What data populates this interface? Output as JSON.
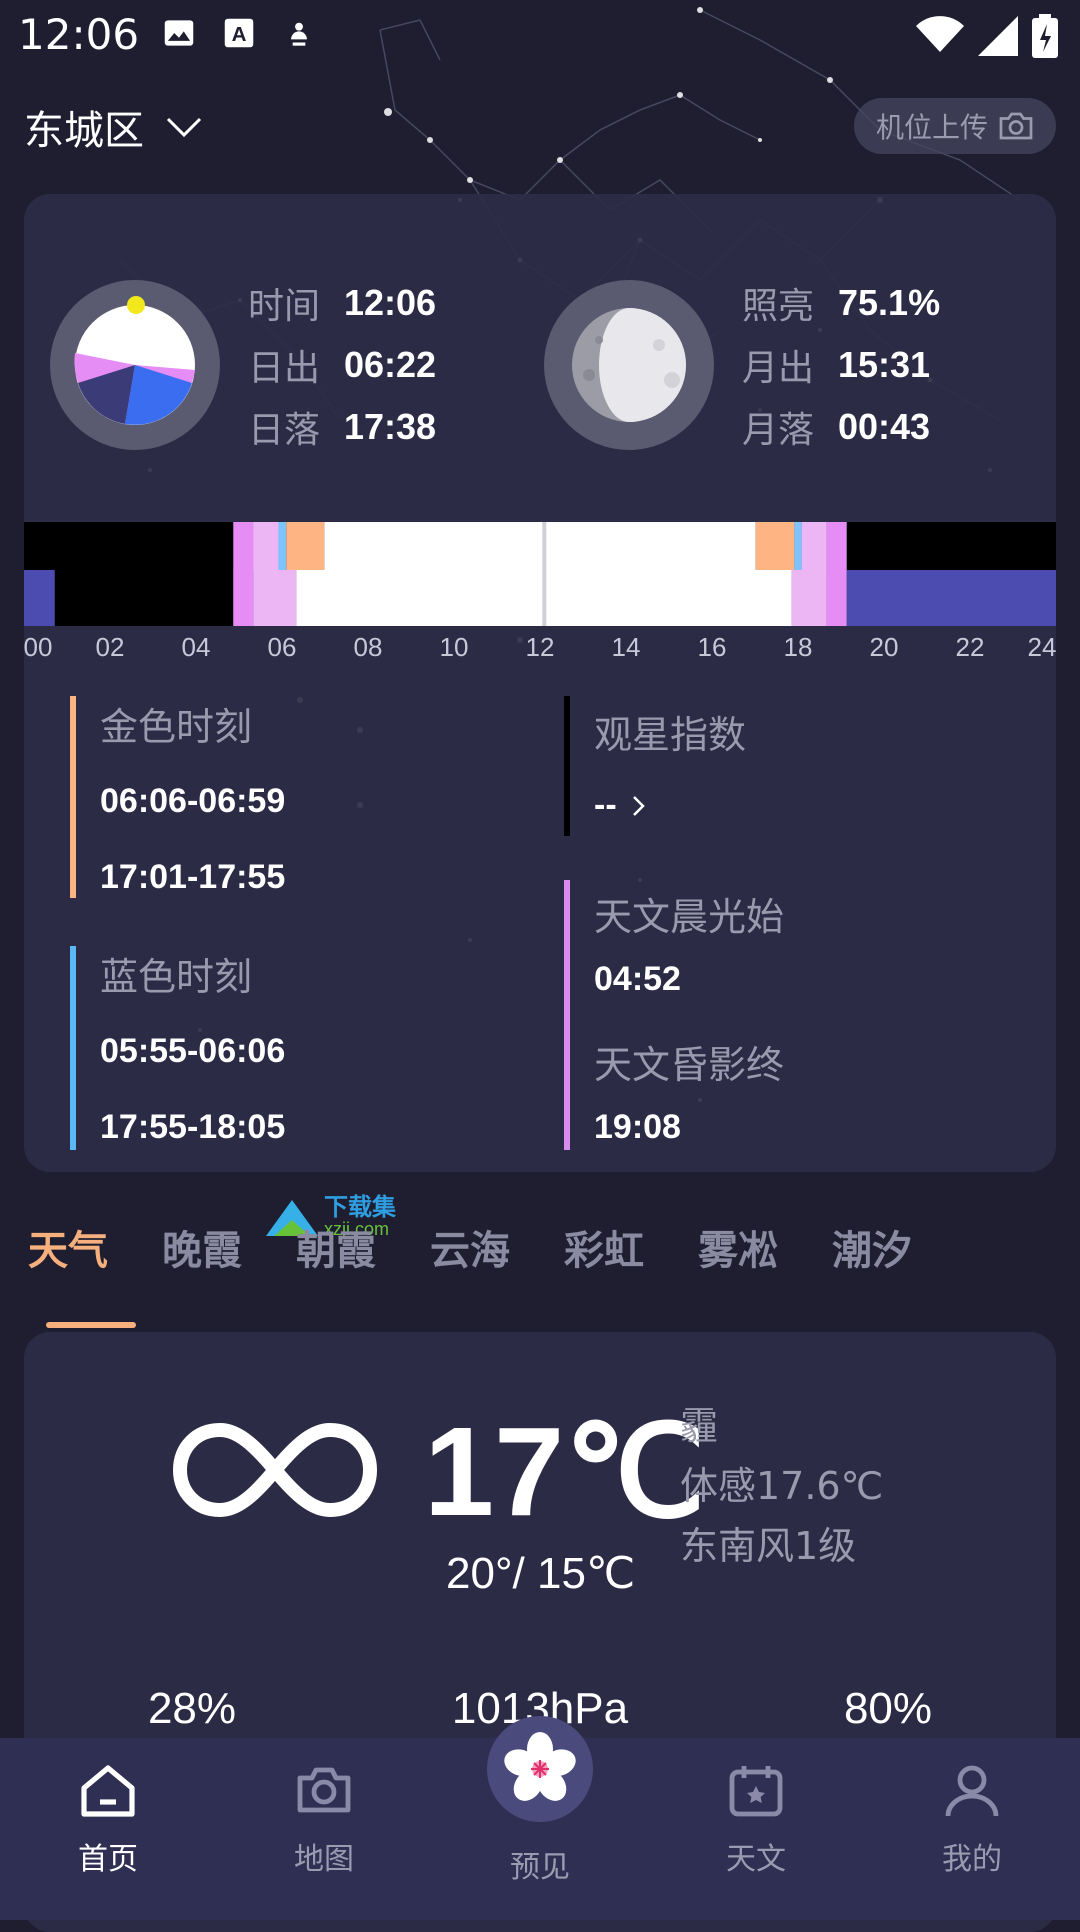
{
  "status_bar": {
    "time": "12:06"
  },
  "header": {
    "city": "东城区",
    "upload_label": "机位上传"
  },
  "sun": {
    "rows": [
      {
        "label": "时间",
        "value": "12:06"
      },
      {
        "label": "日出",
        "value": "06:22"
      },
      {
        "label": "日落",
        "value": "17:38"
      }
    ]
  },
  "moon": {
    "rows": [
      {
        "label": "照亮",
        "value": "75.1%"
      },
      {
        "label": "月出",
        "value": "15:31"
      },
      {
        "label": "月落",
        "value": "00:43"
      }
    ]
  },
  "timeline": {
    "hours": [
      "00",
      "02",
      "04",
      "06",
      "08",
      "10",
      "12",
      "14",
      "16",
      "18",
      "20",
      "22",
      "24"
    ],
    "current_hour": 12.1,
    "colors": {
      "night": "#000000",
      "astro": "#e58cf5",
      "blue": "#7dc4ff",
      "golden": "#ffb583",
      "day": "#ffffff",
      "moon": "#4b4bb0"
    }
  },
  "golden_hour": {
    "title": "金色时刻",
    "morning": "06:06-06:59",
    "evening": "17:01-17:55",
    "color": "#ffb583"
  },
  "blue_hour": {
    "title": "蓝色时刻",
    "morning": "05:55-06:06",
    "evening": "17:55-18:05",
    "color": "#5bb8f5"
  },
  "stargazing": {
    "title": "观星指数",
    "value": "--"
  },
  "astro": {
    "dawn_title": "天文晨光始",
    "dawn_value": "04:52",
    "dusk_title": "天文昏影终",
    "dusk_value": "19:08",
    "color": "#d98cf0"
  },
  "watermark": {
    "text1": "下载集",
    "text2": "xzji.com"
  },
  "tabs": [
    "天气",
    "晚霞",
    "朝霞",
    "云海",
    "彩虹",
    "雾凇",
    "潮汐"
  ],
  "weather": {
    "temp": "17℃",
    "range": "20°/ 15℃",
    "condition": "霾",
    "feels_like": "体感17.6℃",
    "wind": "东南风1级",
    "stats": [
      "28%",
      "1013hPa",
      "80%"
    ]
  },
  "nav": {
    "items": [
      {
        "label": "首页",
        "icon": "home-icon"
      },
      {
        "label": "地图",
        "icon": "camera-icon"
      },
      {
        "label": "预见",
        "icon": "flower-icon"
      },
      {
        "label": "天文",
        "icon": "calendar-icon"
      },
      {
        "label": "我的",
        "icon": "user-icon"
      }
    ]
  }
}
